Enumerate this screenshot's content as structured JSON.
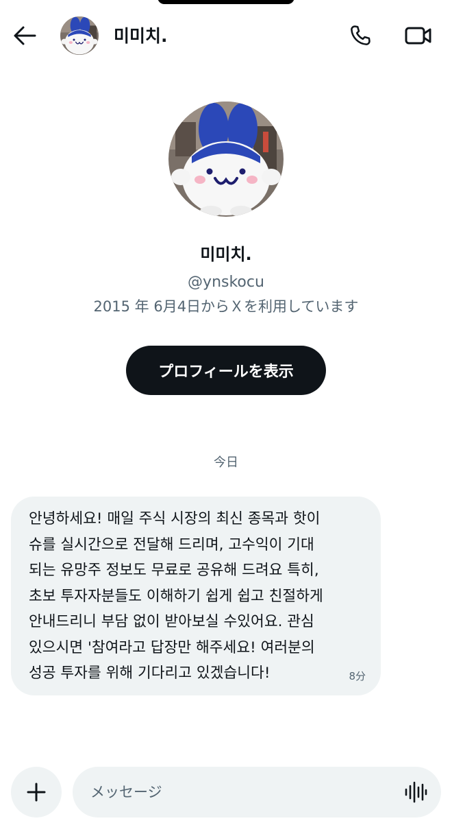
{
  "header": {
    "name": "미미치."
  },
  "profile": {
    "name": "미미치.",
    "handle": "@ynskocu",
    "joined": "2015 年 6月4日からＸを利用しています",
    "view_profile_label": "プロフィールを表示"
  },
  "conversation": {
    "date_separator": "今日",
    "messages": [
      {
        "text": "안녕하세요! 매일 주식 시장의 최신 종목과 핫이\n슈를 실시간으로 전달해 드리며, 고수익이 기대\n되는 유망주 정보도 무료로 공유해 드려요 특히,\n초보 투자자분들도 이해하기 쉽게 쉽고 친절하게\n안내드리니 부담 없이 받아보실 수있어요. 관심\n있으시면 '참여라고 답장만 해주세요! 여러분의\n성공 투자를 위해 기다리고 있겠습니다!",
        "time": "8分"
      }
    ]
  },
  "composer": {
    "placeholder": "メッセージ"
  },
  "icons": {
    "back": "back-arrow-icon",
    "call": "phone-icon",
    "video": "video-camera-icon",
    "plus": "plus-icon",
    "voice": "voice-waveform-icon"
  },
  "colors": {
    "text": "#0f1419",
    "secondary": "#536471",
    "bubble": "#eff3f4",
    "button": "#0f1419"
  }
}
